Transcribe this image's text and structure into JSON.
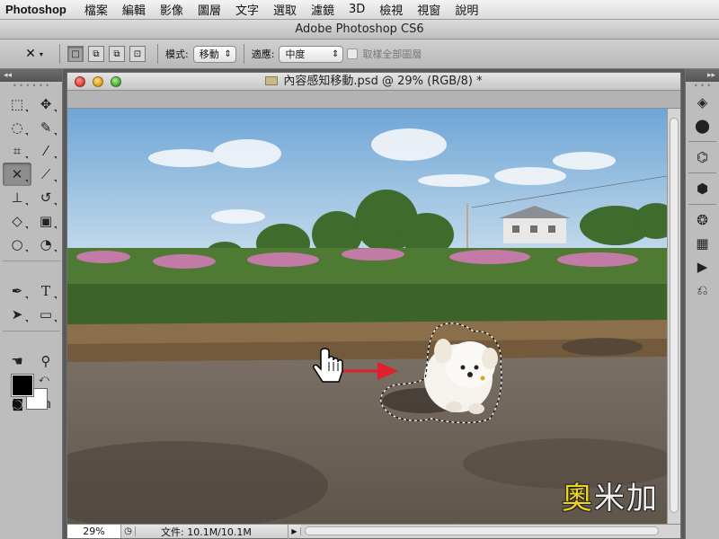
{
  "menubar": {
    "app_name": "Photoshop",
    "items": [
      "檔案",
      "編輯",
      "影像",
      "圖層",
      "文字",
      "選取",
      "濾鏡",
      "3D",
      "檢視",
      "視窗",
      "說明"
    ]
  },
  "window": {
    "title": "Adobe Photoshop CS6"
  },
  "options_bar": {
    "mode_label": "模式:",
    "mode_value": "移動",
    "adapt_label": "適應:",
    "adapt_value": "中度",
    "sample_all_label": "取樣全部圖層",
    "sample_all_checked": false
  },
  "document": {
    "title": "內容感知移動.psd @ 29% (RGB/8) *",
    "zoom": "29%",
    "doc_size": "文件: 10.1M/10.1M"
  },
  "watermark": {
    "text_a": "奧",
    "text_b": "米加"
  },
  "tools": {
    "active": "content-aware-move-tool"
  },
  "colors": {
    "foreground": "#000000",
    "background": "#ffffff",
    "arrow": "#e0202a"
  }
}
